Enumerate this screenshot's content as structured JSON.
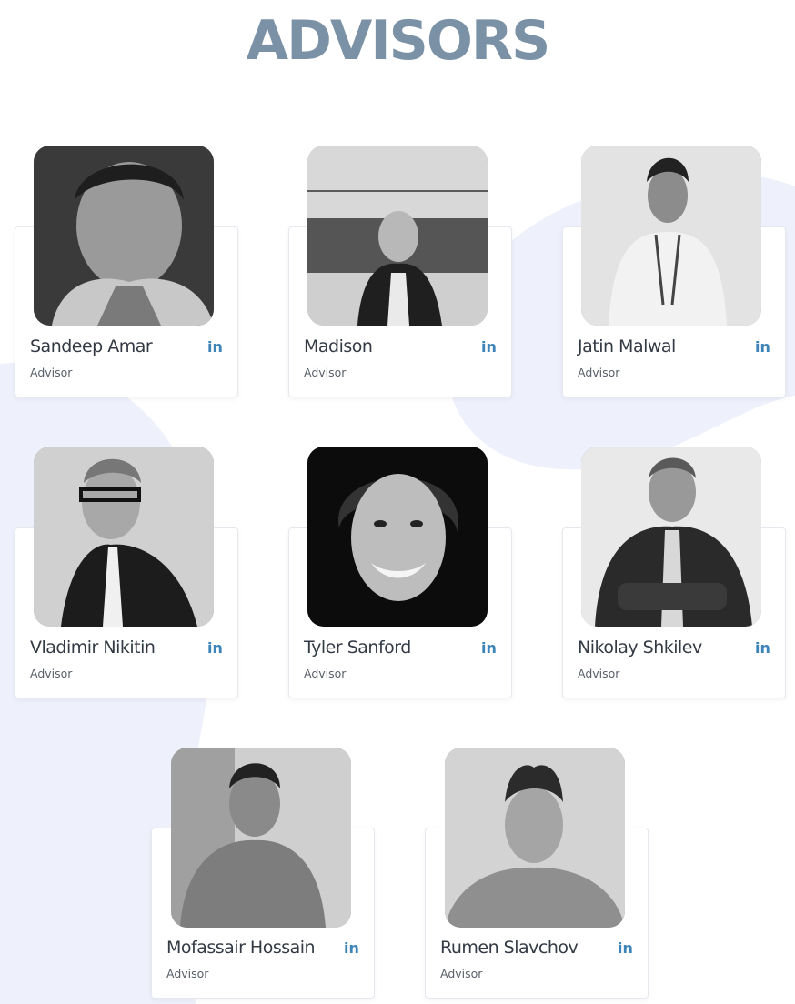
{
  "page": {
    "title": "ADVISORS"
  },
  "advisors": [
    {
      "name": "Sandeep Amar",
      "role": "Advisor",
      "social": "in"
    },
    {
      "name": "Madison",
      "role": "Advisor",
      "social": "in"
    },
    {
      "name": "Jatin Malwal",
      "role": "Advisor",
      "social": "in"
    },
    {
      "name": "Vladimir Nikitin",
      "role": "Advisor",
      "social": "in"
    },
    {
      "name": "Tyler Sanford",
      "role": "Advisor",
      "social": "in"
    },
    {
      "name": "Nikolay Shkilev",
      "role": "Advisor",
      "social": "in"
    },
    {
      "name": "Mofassair Hossain",
      "role": "Advisor",
      "social": "in"
    },
    {
      "name": "Rumen Slavchov",
      "role": "Advisor",
      "social": "in"
    }
  ],
  "colors": {
    "title": "#7b92a6",
    "linkedin": "#3d84b8",
    "blob": "#eef0fb"
  }
}
